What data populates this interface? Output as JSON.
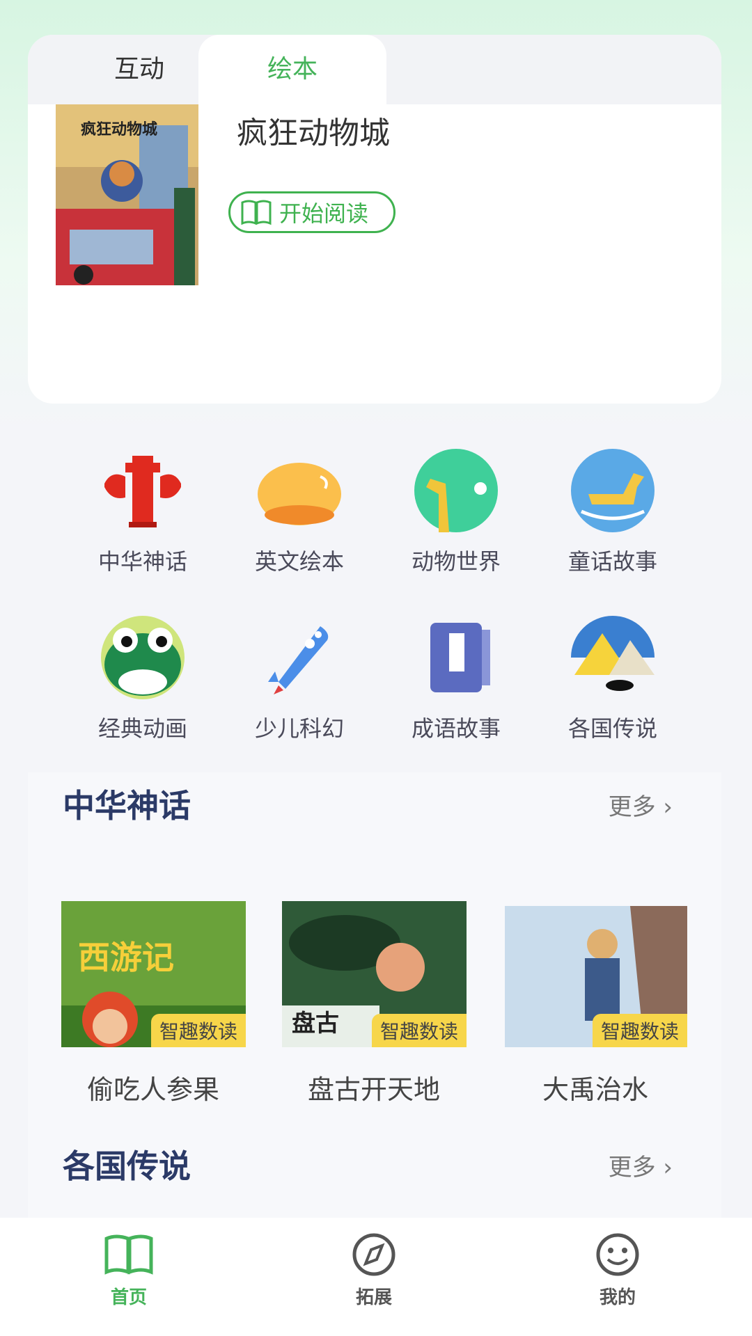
{
  "tabs": [
    {
      "label": "互动",
      "active": false
    },
    {
      "label": "绘本",
      "active": true
    }
  ],
  "featured": {
    "title": "疯狂动物城",
    "cover_text": "疯狂动物城",
    "read_label": "开始阅读"
  },
  "categories": [
    {
      "label": "中华神话",
      "icon": "red-hydrant-icon"
    },
    {
      "label": "英文绘本",
      "icon": "orange-bowl-icon"
    },
    {
      "label": "动物世界",
      "icon": "giraffe-icon"
    },
    {
      "label": "童话故事",
      "icon": "rocking-horse-icon"
    },
    {
      "label": "经典动画",
      "icon": "frog-icon"
    },
    {
      "label": "少儿科幻",
      "icon": "rocket-icon"
    },
    {
      "label": "成语故事",
      "icon": "book-icon"
    },
    {
      "label": "各国传说",
      "icon": "pyramid-icon"
    }
  ],
  "sections": [
    {
      "title": "中华神话",
      "more": "更多",
      "items": [
        {
          "label": "偷吃人参果",
          "badge": "智趣数读",
          "cover_text": "西游记"
        },
        {
          "label": "盘古开天地",
          "badge": "智趣数读",
          "cover_text": "盘古"
        },
        {
          "label": "大禹治水",
          "badge": "智趣数读"
        }
      ]
    },
    {
      "title": "各国传说",
      "more": "更多"
    }
  ],
  "nav": [
    {
      "label": "首页",
      "active": true
    },
    {
      "label": "拓展",
      "active": false
    },
    {
      "label": "我的",
      "active": false
    }
  ],
  "colors": {
    "accent": "#3fb24f",
    "title_blue": "#2b3a67",
    "badge": "#f7d64a"
  }
}
